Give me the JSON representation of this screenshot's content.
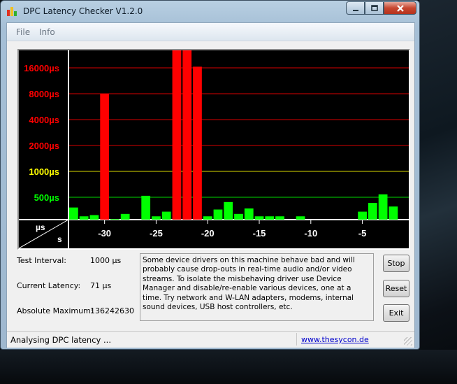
{
  "window": {
    "title": "DPC Latency Checker V1.2.0",
    "icon": "bar-chart-app-icon",
    "buttons": {
      "minimize": "minimize-icon",
      "maximize": "maximize-icon",
      "close": "close-icon"
    }
  },
  "menu": {
    "items": [
      {
        "label": "File"
      },
      {
        "label": "Info"
      }
    ]
  },
  "chart_data": {
    "type": "bar",
    "title": "",
    "xlabel": "s",
    "ylabel": "µs",
    "x_ticks": [
      "-30",
      "-25",
      "-20",
      "-15",
      "-10",
      "-5"
    ],
    "y_ticks": [
      {
        "label": "16000µs",
        "value": 16000,
        "color": "#ff0000"
      },
      {
        "label": "8000µs",
        "value": 8000,
        "color": "#ff0000"
      },
      {
        "label": "4000µs",
        "value": 4000,
        "color": "#ff0000"
      },
      {
        "label": "2000µs",
        "value": 2000,
        "color": "#ff0000"
      },
      {
        "label": "1000µs",
        "value": 1000,
        "color": "#ffff00"
      },
      {
        "label": "500µs",
        "value": 500,
        "color": "#00ff00"
      }
    ],
    "x_range": [
      -33,
      -1
    ],
    "y_scale": "log2",
    "grid": true,
    "colors": {
      "ok": "#00ff00",
      "warning": "#ffff00",
      "bad": "#ff0000",
      "background": "#000000"
    },
    "bars": [
      {
        "x": -33,
        "value": 380
      },
      {
        "x": -32,
        "value": 300
      },
      {
        "x": -31,
        "value": 310
      },
      {
        "x": -30,
        "value": 8000
      },
      {
        "x": -29,
        "value": 280
      },
      {
        "x": -28,
        "value": 320
      },
      {
        "x": -27,
        "value": 240
      },
      {
        "x": -26,
        "value": 520
      },
      {
        "x": -25,
        "value": 300
      },
      {
        "x": -24,
        "value": 340
      },
      {
        "x": -23,
        "value": 28000
      },
      {
        "x": -22,
        "value": 28000
      },
      {
        "x": -21,
        "value": 16500
      },
      {
        "x": -20,
        "value": 300
      },
      {
        "x": -19,
        "value": 360
      },
      {
        "x": -18,
        "value": 440
      },
      {
        "x": -17,
        "value": 320
      },
      {
        "x": -16,
        "value": 370
      },
      {
        "x": -15,
        "value": 300
      },
      {
        "x": -14,
        "value": 300
      },
      {
        "x": -13,
        "value": 300
      },
      {
        "x": -12,
        "value": 240
      },
      {
        "x": -11,
        "value": 300
      },
      {
        "x": -10,
        "value": 230
      },
      {
        "x": -9,
        "value": 260
      },
      {
        "x": -8,
        "value": 230
      },
      {
        "x": -7,
        "value": 210
      },
      {
        "x": -6,
        "value": 250
      },
      {
        "x": -5,
        "value": 340
      },
      {
        "x": -4,
        "value": 430
      },
      {
        "x": -3,
        "value": 540
      },
      {
        "x": -2,
        "value": 390
      },
      {
        "x": -1,
        "value": 210
      }
    ]
  },
  "info": {
    "test_interval_label": "Test Interval:",
    "test_interval_value": "1000 µs",
    "current_latency_label": "Current Latency:",
    "current_latency_value": "71 µs",
    "absolute_maximum_label": "Absolute Maximum:",
    "absolute_maximum_value": "136242630"
  },
  "description": "Some device drivers on this machine behave bad and will probably cause drop-outs in real-time audio and/or video streams. To isolate the misbehaving driver use Device Manager and disable/re-enable various devices, one at a time. Try network and W-LAN adapters, modems, internal sound devices, USB host controllers, etc.",
  "actions": {
    "stop_label": "Stop",
    "reset_label": "Reset",
    "exit_label": "Exit"
  },
  "status": {
    "text": "Analysing DPC latency ...",
    "link": "www.thesycon.de"
  }
}
